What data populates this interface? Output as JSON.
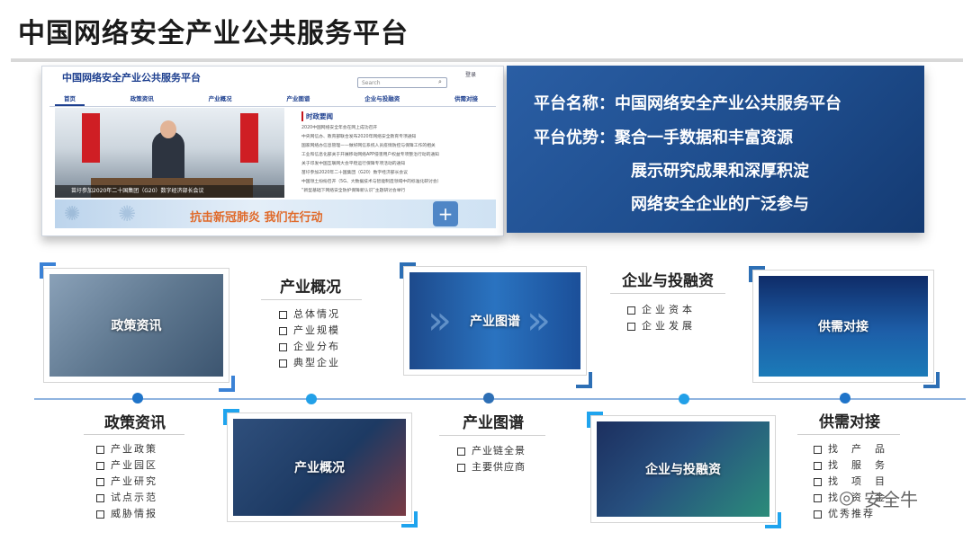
{
  "page": {
    "title": "中国网络安全产业公共服务平台"
  },
  "website": {
    "title": "中国网络安全产业公共服务平台",
    "search_placeholder": "Search",
    "login": "登录",
    "nav": [
      "首页",
      "政策资讯",
      "产业概况",
      "产业图谱",
      "企业与投融资",
      "供需对接"
    ],
    "photo_caption": "苗圩参加2020年二十国集团（G20）数字经济部长会议",
    "news_heading": "时政要闻",
    "news": [
      "2020中国网络安全年会在网上成功召开",
      "中央网信办、教育部联合发布2020年网络安全教育专项通知",
      "国家网络办信息管理——做好网信系统人员疫情防控与保障工作的相关",
      "工业和信息化部关于开展移动网络APP侵害用户权益专项整治行动的通知",
      "关于印发中国互联网大会平稳运行保障专项活动的通知",
      "苗圩参加2020年二十国集团（G20）数字经济部长会议",
      "中国领土纷纷召开（5G、大数据技术与智能制造领域中的标准化研讨会）",
      "“新型基础下网络安全防护保障新认识”主题研讨会举行"
    ],
    "banner_text": "抗击新冠肺炎 我们在行动"
  },
  "info_panel": {
    "name_label": "平台名称：",
    "name_value": "中国网络安全产业公共服务平台",
    "adv_label": "平台优势：",
    "adv_values": [
      "聚合一手数据和丰富资源",
      "展示研究成果和深厚积淀",
      "网络安全企业的广泛参与"
    ]
  },
  "cards": [
    {
      "label": "政策资讯"
    },
    {
      "label": "产业概况"
    },
    {
      "label": "产业图谱"
    },
    {
      "label": "企业与投融资"
    },
    {
      "label": "供需对接"
    }
  ],
  "blocks": {
    "policy": {
      "title": "政策资讯",
      "items": [
        "产业政策",
        "产业园区",
        "产业研究",
        "试点示范",
        "威胁情报"
      ]
    },
    "overview": {
      "title": "产业概况",
      "items": [
        "总体情况",
        "产业规模",
        "企业分布",
        "典型企业"
      ]
    },
    "map": {
      "title": "产业图谱",
      "items": [
        "产业链全景",
        "主要供应商"
      ]
    },
    "invest": {
      "title": "企业与投融资",
      "items": [
        "企业资本",
        "企业发展"
      ]
    },
    "supply": {
      "title": "供需对接",
      "items": [
        "找　产　品",
        "找　服　务",
        "找　项　目",
        "找　资　金",
        "优秀推荐"
      ]
    }
  },
  "watermark": {
    "text": "安全牛",
    "icon": "wechat-icon"
  },
  "colors": {
    "accent": "#2f7fd8",
    "panel": "#1e4d8d",
    "dot": "#1f74c9"
  }
}
